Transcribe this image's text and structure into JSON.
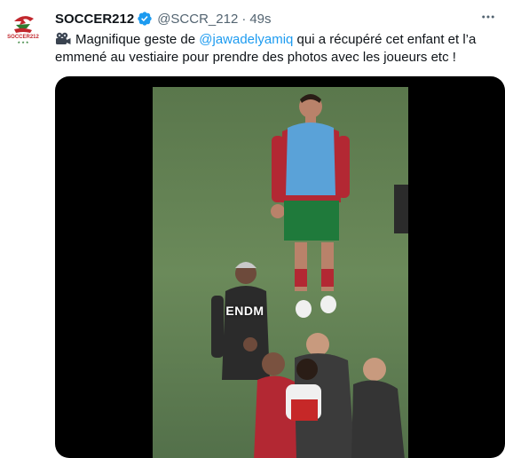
{
  "tweet": {
    "author_name": "SOCCER212",
    "handle": "@SCCR_212",
    "separator": "·",
    "time": "49s",
    "text_before": "Magnifique geste de ",
    "mention": "@jawadelyamiq",
    "text_after": " qui a récupéré cet enfant et l’a emmené au vestiaire pour prendre des photos avec les joueurs etc !",
    "avatar_text": "SOCCER212",
    "verified_color": "#1d9bf0"
  },
  "media": {
    "watermark": "ENDM"
  },
  "icons": {
    "verified": "verified-badge-icon",
    "camera": "movie-camera-icon",
    "more": "more-options-icon"
  }
}
